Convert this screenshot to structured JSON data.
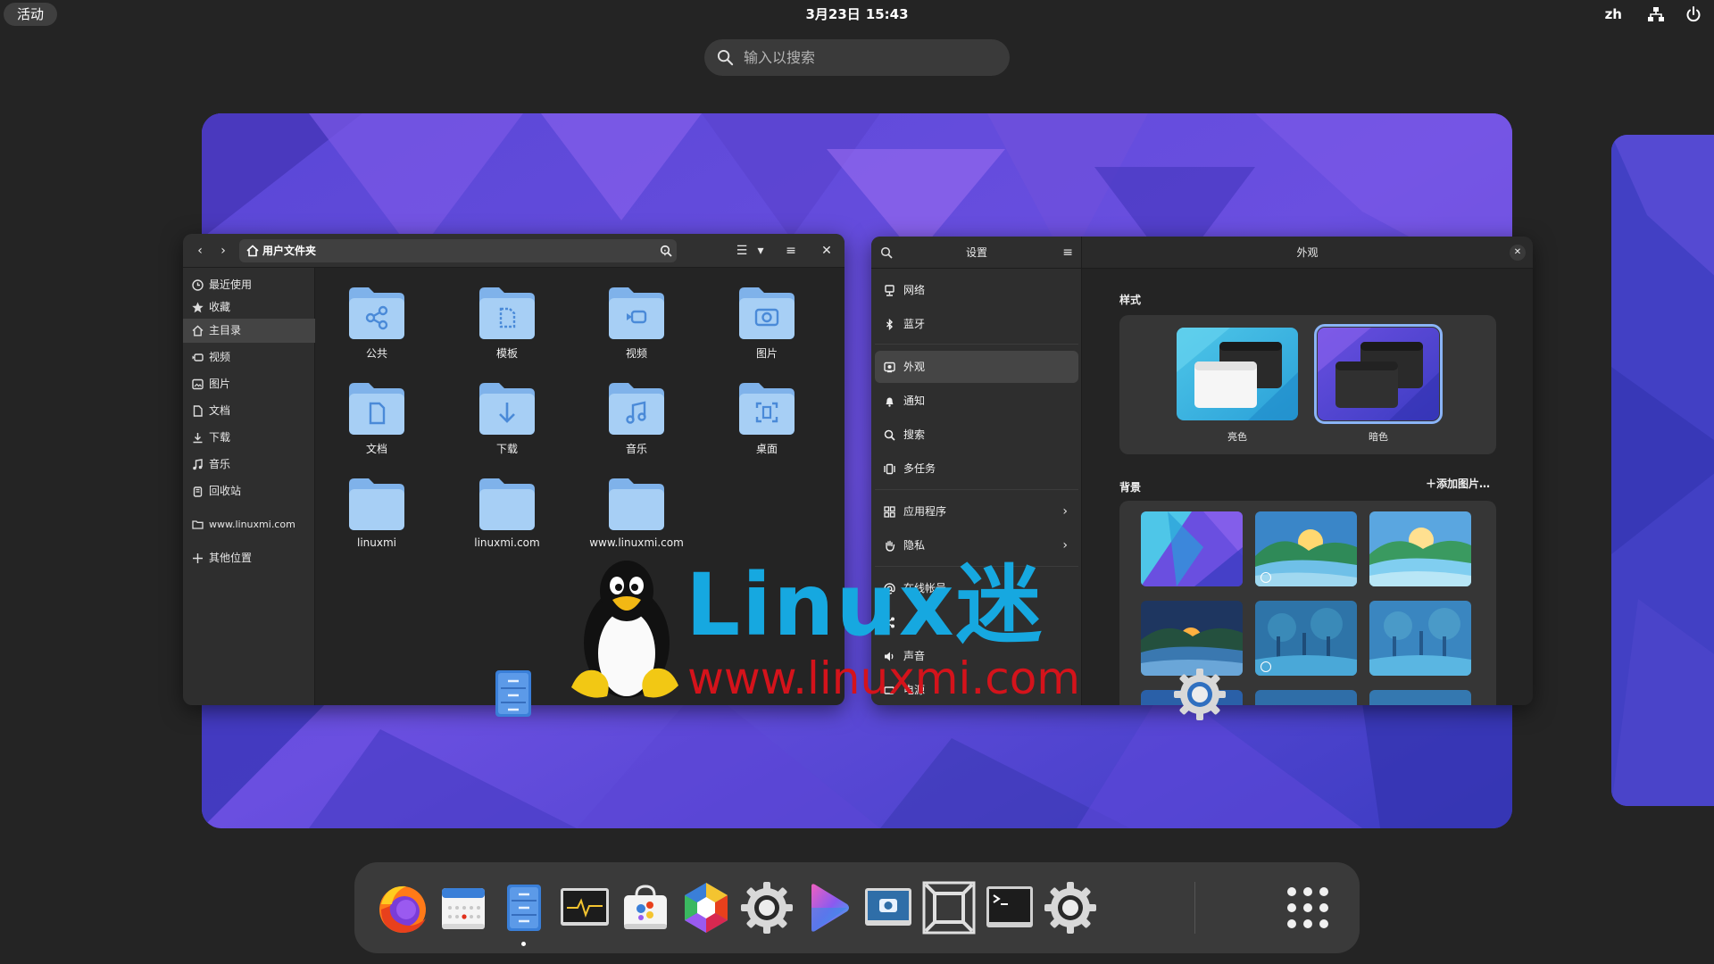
{
  "topbar": {
    "activities": "活动",
    "date": "3月23日",
    "time": "15:43",
    "language": "zh"
  },
  "search": {
    "placeholder": "输入以搜索"
  },
  "files": {
    "path_label": "用户文件夹",
    "sidebar": [
      {
        "label": "最近使用",
        "icon": "clock-icon"
      },
      {
        "label": "收藏",
        "icon": "star-icon"
      },
      {
        "label": "主目录",
        "icon": "home-icon",
        "active": true
      },
      {
        "label": "视频",
        "icon": "video-icon"
      },
      {
        "label": "图片",
        "icon": "image-icon"
      },
      {
        "label": "文档",
        "icon": "document-icon"
      },
      {
        "label": "下载",
        "icon": "download-icon"
      },
      {
        "label": "音乐",
        "icon": "music-icon"
      },
      {
        "label": "回收站",
        "icon": "trash-icon"
      },
      {
        "label": "www.linuxmi.com",
        "icon": "folder-icon"
      },
      {
        "label": "其他位置",
        "icon": "plus-icon"
      }
    ],
    "folders": [
      {
        "label": "公共",
        "icon": "share-icon"
      },
      {
        "label": "模板",
        "icon": "template-icon"
      },
      {
        "label": "视频",
        "icon": "video-icon"
      },
      {
        "label": "图片",
        "icon": "camera-icon"
      },
      {
        "label": "文档",
        "icon": "document-icon"
      },
      {
        "label": "下载",
        "icon": "download-icon"
      },
      {
        "label": "音乐",
        "icon": "music-icon"
      },
      {
        "label": "桌面",
        "icon": "desktop-icon"
      },
      {
        "label": "linuxmi",
        "icon": ""
      },
      {
        "label": "linuxmi.com",
        "icon": ""
      },
      {
        "label": "www.linuxmi.com",
        "icon": ""
      }
    ]
  },
  "settings": {
    "sidebar_title": "设置",
    "main_title": "外观",
    "items": [
      {
        "label": "网络",
        "icon": "network-icon"
      },
      {
        "label": "蓝牙",
        "icon": "bluetooth-icon"
      },
      {
        "label": "外观",
        "icon": "appearance-icon",
        "active": true
      },
      {
        "label": "通知",
        "icon": "bell-icon"
      },
      {
        "label": "搜索",
        "icon": "search-icon"
      },
      {
        "label": "多任务",
        "icon": "multitask-icon"
      },
      {
        "label": "应用程序",
        "icon": "apps-icon",
        "chevron": true
      },
      {
        "label": "隐私",
        "icon": "hand-icon",
        "chevron": true
      },
      {
        "label": "在线帐号",
        "icon": "at-icon"
      },
      {
        "label": "",
        "icon": "share-icon"
      },
      {
        "label": "声音",
        "icon": "speaker-icon"
      },
      {
        "label": "电源",
        "icon": "power-icon"
      }
    ],
    "style_heading": "样式",
    "style_light": "亮色",
    "style_dark": "暗色",
    "selected_style": "dark",
    "background_heading": "背景",
    "add_picture": "添加图片…"
  },
  "watermark": {
    "brand": "Linux迷",
    "url": "www.linuxmi.com"
  },
  "dash": {
    "apps": [
      {
        "name": "firefox",
        "icon": "firefox-icon"
      },
      {
        "name": "calendar",
        "icon": "calendar-icon"
      },
      {
        "name": "files",
        "icon": "files-icon",
        "running": true
      },
      {
        "name": "system-monitor",
        "icon": "system-monitor-icon"
      },
      {
        "name": "software",
        "icon": "software-icon"
      },
      {
        "name": "app-hex",
        "icon": "hex-app-icon"
      },
      {
        "name": "settings",
        "icon": "settings-icon"
      },
      {
        "name": "video-player",
        "icon": "play-icon"
      },
      {
        "name": "screenshot",
        "icon": "screenshot-icon"
      },
      {
        "name": "boxes",
        "icon": "boxes-icon"
      },
      {
        "name": "terminal",
        "icon": "terminal-icon"
      },
      {
        "name": "settings-2",
        "icon": "settings-icon"
      },
      {
        "name": "show-apps",
        "icon": "app-grid-icon"
      }
    ]
  },
  "colors": {
    "accent": "#8ab4f8",
    "folder": "#9cc6f0",
    "wallpaper": "#4a40c8",
    "brand_blue": "#16a8e0",
    "brand_red": "#d4131b"
  }
}
